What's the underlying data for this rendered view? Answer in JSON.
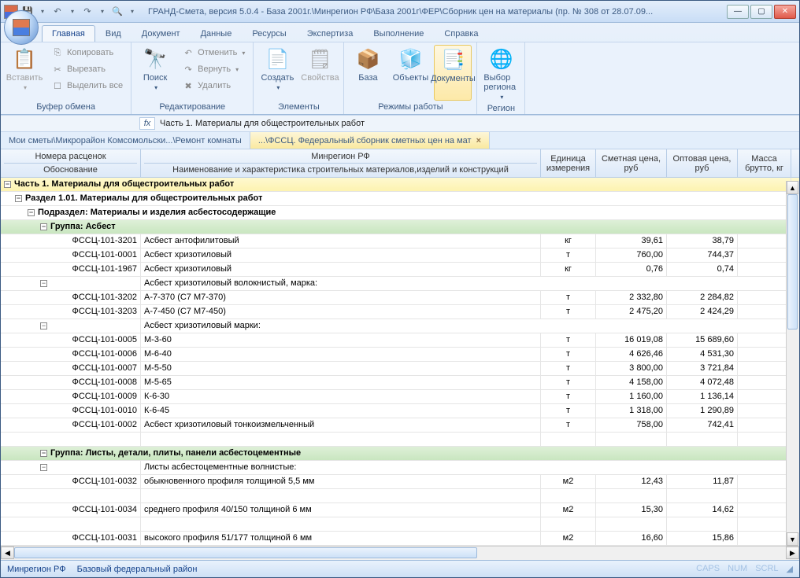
{
  "title": "ГРАНД-Смета, версия 5.0.4 - База 2001г.\\Минрегион РФ\\База 2001г\\ФЕР\\Сборник цен на материалы (пр. № 308 от 28.07.09...",
  "tabs": [
    "Главная",
    "Вид",
    "Документ",
    "Данные",
    "Ресурсы",
    "Экспертиза",
    "Выполнение",
    "Справка"
  ],
  "ribbon": {
    "clipboard": {
      "title": "Буфер обмена",
      "paste": "Вставить",
      "copy": "Копировать",
      "cut": "Вырезать",
      "selectall": "Выделить все"
    },
    "edit": {
      "title": "Редактирование",
      "find": "Поиск",
      "undo": "Отменить",
      "redo": "Вернуть",
      "delete": "Удалить"
    },
    "elements": {
      "title": "Элементы",
      "create": "Создать",
      "props": "Свойства"
    },
    "modes": {
      "title": "Режимы работы",
      "base": "База",
      "objects": "Объекты",
      "docs": "Документы"
    },
    "region": {
      "title": "Регион",
      "choose": "Выбор региона"
    }
  },
  "formula": {
    "ref": "",
    "value": "Часть 1. Материалы для общестроительных работ"
  },
  "docTabs": [
    {
      "label": "Мои сметы\\Микрорайон Комсомольски...\\Ремонт комнаты",
      "closable": false
    },
    {
      "label": "...\\ФССЦ. Федеральный сборник сметных цен на мат",
      "closable": true
    }
  ],
  "headers": {
    "code": "Номера расценок",
    "main": "Минрегион РФ",
    "unit": "Единица измерения",
    "price1": "Сметная цена, руб",
    "price2": "Оптовая цена, руб",
    "mass": "Масса брутто, кг",
    "sub1": "Обоснование",
    "sub2": "Наименование и характеристика строительных материалов,изделий и конструкций"
  },
  "rows": [
    {
      "type": "part",
      "label": "Часть 1. Материалы для общестроительных работ"
    },
    {
      "type": "section",
      "label": "Раздел 1.01. Материалы для общестроительных работ"
    },
    {
      "type": "subsec",
      "label": "Подраздел: Материалы и изделия асбестосодержащие"
    },
    {
      "type": "group",
      "label": "Группа: Асбест"
    },
    {
      "type": "item",
      "code": "ФССЦ-101-3201",
      "name": "Асбест антофилитовый",
      "unit": "кг",
      "p1": "39,61",
      "p2": "38,79"
    },
    {
      "type": "item",
      "code": "ФССЦ-101-0001",
      "name": "Асбест хризотиловый",
      "unit": "т",
      "p1": "760,00",
      "p2": "744,37"
    },
    {
      "type": "item",
      "code": "ФССЦ-101-1967",
      "name": "Асбест хризотиловый",
      "unit": "кг",
      "p1": "0,76",
      "p2": "0,74"
    },
    {
      "type": "subgroup",
      "label": "Асбест хризотиловый волокнистый, марка:"
    },
    {
      "type": "item",
      "code": "ФССЦ-101-3202",
      "name": "А-7-370 (С7 М7-370)",
      "unit": "т",
      "p1": "2 332,80",
      "p2": "2 284,82"
    },
    {
      "type": "item",
      "code": "ФССЦ-101-3203",
      "name": "А-7-450 (С7 М7-450)",
      "unit": "т",
      "p1": "2 475,20",
      "p2": "2 424,29"
    },
    {
      "type": "subgroup",
      "label": "Асбест хризотиловый марки:"
    },
    {
      "type": "item",
      "code": "ФССЦ-101-0005",
      "name": "М-3-60",
      "unit": "т",
      "p1": "16 019,08",
      "p2": "15 689,60"
    },
    {
      "type": "item",
      "code": "ФССЦ-101-0006",
      "name": "М-6-40",
      "unit": "т",
      "p1": "4 626,46",
      "p2": "4 531,30"
    },
    {
      "type": "item",
      "code": "ФССЦ-101-0007",
      "name": "М-5-50",
      "unit": "т",
      "p1": "3 800,00",
      "p2": "3 721,84"
    },
    {
      "type": "item",
      "code": "ФССЦ-101-0008",
      "name": "М-5-65",
      "unit": "т",
      "p1": "4 158,00",
      "p2": "4 072,48"
    },
    {
      "type": "item",
      "code": "ФССЦ-101-0009",
      "name": "К-6-30",
      "unit": "т",
      "p1": "1 160,00",
      "p2": "1 136,14"
    },
    {
      "type": "item",
      "code": "ФССЦ-101-0010",
      "name": "К-6-45",
      "unit": "т",
      "p1": "1 318,00",
      "p2": "1 290,89"
    },
    {
      "type": "item",
      "code": "ФССЦ-101-0002",
      "name": "Асбест хризотиловый тонкоизмельченный",
      "unit": "т",
      "p1": "758,00",
      "p2": "742,41"
    },
    {
      "type": "spacer"
    },
    {
      "type": "group",
      "label": "Группа: Листы, детали, плиты, панели асбестоцементные"
    },
    {
      "type": "subgroup",
      "label": "Листы асбестоцементные волнистые:"
    },
    {
      "type": "item",
      "code": "ФССЦ-101-0032",
      "name": "обыкновенного профиля толщиной 5,5 мм",
      "unit": "м2",
      "p1": "12,43",
      "p2": "11,87"
    },
    {
      "type": "spacer"
    },
    {
      "type": "item",
      "code": "ФССЦ-101-0034",
      "name": "среднего профиля 40/150 толщиной 6 мм",
      "unit": "м2",
      "p1": "15,30",
      "p2": "14,62"
    },
    {
      "type": "spacer"
    },
    {
      "type": "item",
      "code": "ФССЦ-101-0031",
      "name": "высокого профиля 51/177 толщиной 6 мм",
      "unit": "м2",
      "p1": "16,60",
      "p2": "15,86"
    }
  ],
  "status": {
    "left1": "Минрегион РФ",
    "left2": "Базовый федеральный район",
    "caps": "CAPS",
    "num": "NUM",
    "scrl": "SCRL"
  }
}
